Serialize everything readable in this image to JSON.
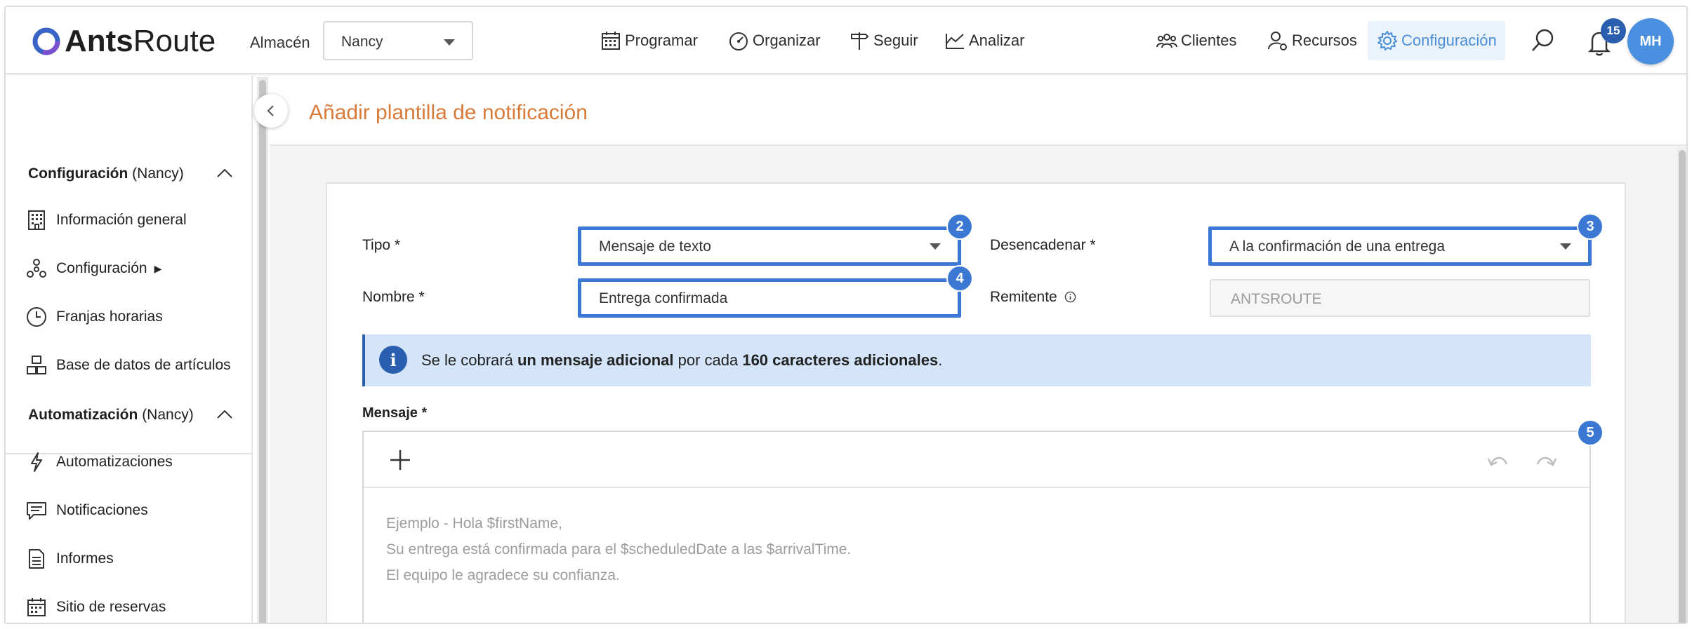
{
  "app": {
    "logo_strong": "Ants",
    "logo_light": "Route"
  },
  "header": {
    "warehouse_label": "Almacén",
    "warehouse_value": "Nancy",
    "nav": {
      "programar": "Programar",
      "organizar": "Organizar",
      "seguir": "Seguir",
      "analizar": "Analizar",
      "clientes": "Clientes",
      "recursos": "Recursos",
      "configuracion": "Configuración"
    },
    "notification_count": "15",
    "avatar_initials": "MH"
  },
  "sidebar": {
    "section1_title": "Configuración",
    "section1_scope": "(Nancy)",
    "section1_items": [
      "Información general",
      "Configuración",
      "Franjas horarias",
      "Base de datos de artículos"
    ],
    "section2_title": "Automatización",
    "section2_scope": "(Nancy)",
    "section2_items": [
      "Automatizaciones",
      "Notificaciones",
      "Informes",
      "Sitio de reservas"
    ]
  },
  "page": {
    "title": "Añadir plantilla de notificación"
  },
  "form": {
    "tipo_label": "Tipo *",
    "tipo_value": "Mensaje de texto",
    "desencadenar_label": "Desencadenar *",
    "desencadenar_value": "A la confirmación de una entrega",
    "nombre_label": "Nombre *",
    "nombre_value": "Entrega confirmada",
    "remitente_label": "Remitente",
    "remitente_value": "ANTSROUTE",
    "markers": [
      "2",
      "3",
      "4",
      "5"
    ]
  },
  "info": {
    "text_1": "Se le cobrará ",
    "bold_1": "un mensaje adicional",
    "text_2": " por cada ",
    "bold_2": "160 caracteres adicionales",
    "text_3": "."
  },
  "message": {
    "label": "Mensaje *",
    "placeholder_lines": [
      "Ejemplo - Hola $firstName,",
      "Su entrega está confirmada para el $scheduledDate a las $arrivalTime.",
      "El equipo le agradece su confianza."
    ]
  },
  "colors": {
    "accent": "#3a78d4",
    "title_orange": "#d87a3a",
    "info_bg": "#d4e5fa",
    "active_nav": "#4a8fd6"
  }
}
